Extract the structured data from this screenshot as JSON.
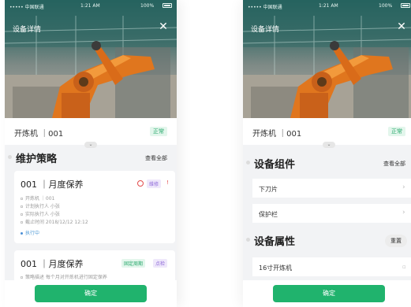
{
  "status_bar": {
    "signal": "••••• 中国联通 ",
    "time": "1:21 AM",
    "battery": "100%"
  },
  "header": {
    "title": "设备详情"
  },
  "device": {
    "name": "开炼机 ｜001",
    "status": "正常"
  },
  "left_screen": {
    "section": {
      "title": "维护策略",
      "link": "查看全部"
    },
    "card1": {
      "title": "001 ｜月度保养",
      "tag": "维修",
      "rows": [
        "开炼机 ｜001",
        "计划执行人 小张",
        "实际执行人 小张",
        "截止时间 2018/12/12 12:12"
      ],
      "status": "执行中"
    },
    "card2": {
      "title": "001 ｜月度保养",
      "tag1": "固定周期",
      "tag2": "点检",
      "row": "策略描述 每个月对开炼机进行固定保养"
    }
  },
  "right_screen": {
    "components": {
      "title": "设备组件",
      "link": "查看全部",
      "items": [
        "下刀片",
        "保护栏"
      ]
    },
    "attributes": {
      "title": "设备属性",
      "reset": "重置",
      "items": [
        "16寸开炼机"
      ]
    }
  },
  "footer": {
    "confirm": "确定"
  },
  "colors": {
    "primary": "#20b36d",
    "status_green": "#27a86b",
    "purple": "#8e6ad8",
    "red": "#e24a4a"
  }
}
